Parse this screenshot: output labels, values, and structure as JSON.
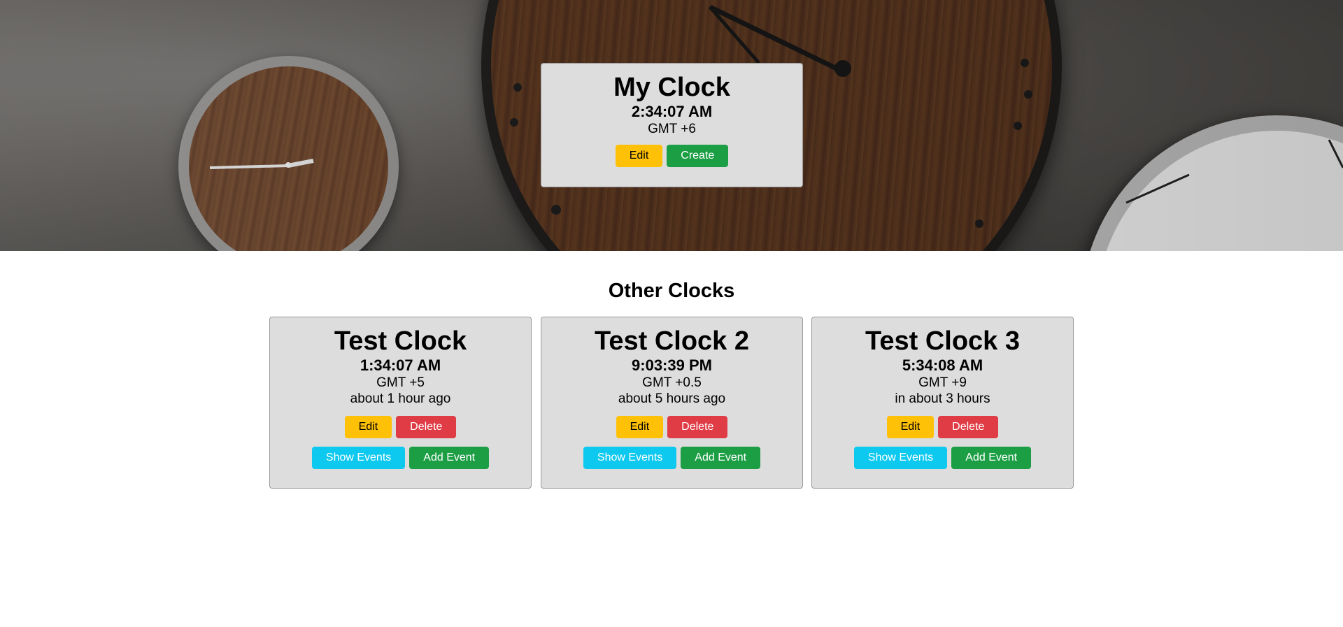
{
  "hero": {
    "my_clock": {
      "title": "My Clock",
      "time": "2:34:07 AM",
      "timezone": "GMT +6",
      "edit_label": "Edit",
      "create_label": "Create"
    }
  },
  "section": {
    "title": "Other Clocks"
  },
  "clocks": [
    {
      "title": "Test Clock",
      "time": "1:34:07 AM",
      "timezone": "GMT +5",
      "relative": "about 1 hour ago",
      "edit_label": "Edit",
      "delete_label": "Delete",
      "show_events_label": "Show Events",
      "add_event_label": "Add Event"
    },
    {
      "title": "Test Clock 2",
      "time": "9:03:39 PM",
      "timezone": "GMT +0.5",
      "relative": "about 5 hours ago",
      "edit_label": "Edit",
      "delete_label": "Delete",
      "show_events_label": "Show Events",
      "add_event_label": "Add Event"
    },
    {
      "title": "Test Clock 3",
      "time": "5:34:08 AM",
      "timezone": "GMT +9",
      "relative": "in about 3 hours",
      "edit_label": "Edit",
      "delete_label": "Delete",
      "show_events_label": "Show Events",
      "add_event_label": "Add Event"
    }
  ],
  "colors": {
    "edit": "#ffc107",
    "create": "#1c9e44",
    "delete": "#e03c46",
    "show_events": "#0dc8ef",
    "add_event": "#1c9e44",
    "card_bg": "#dddddd"
  }
}
